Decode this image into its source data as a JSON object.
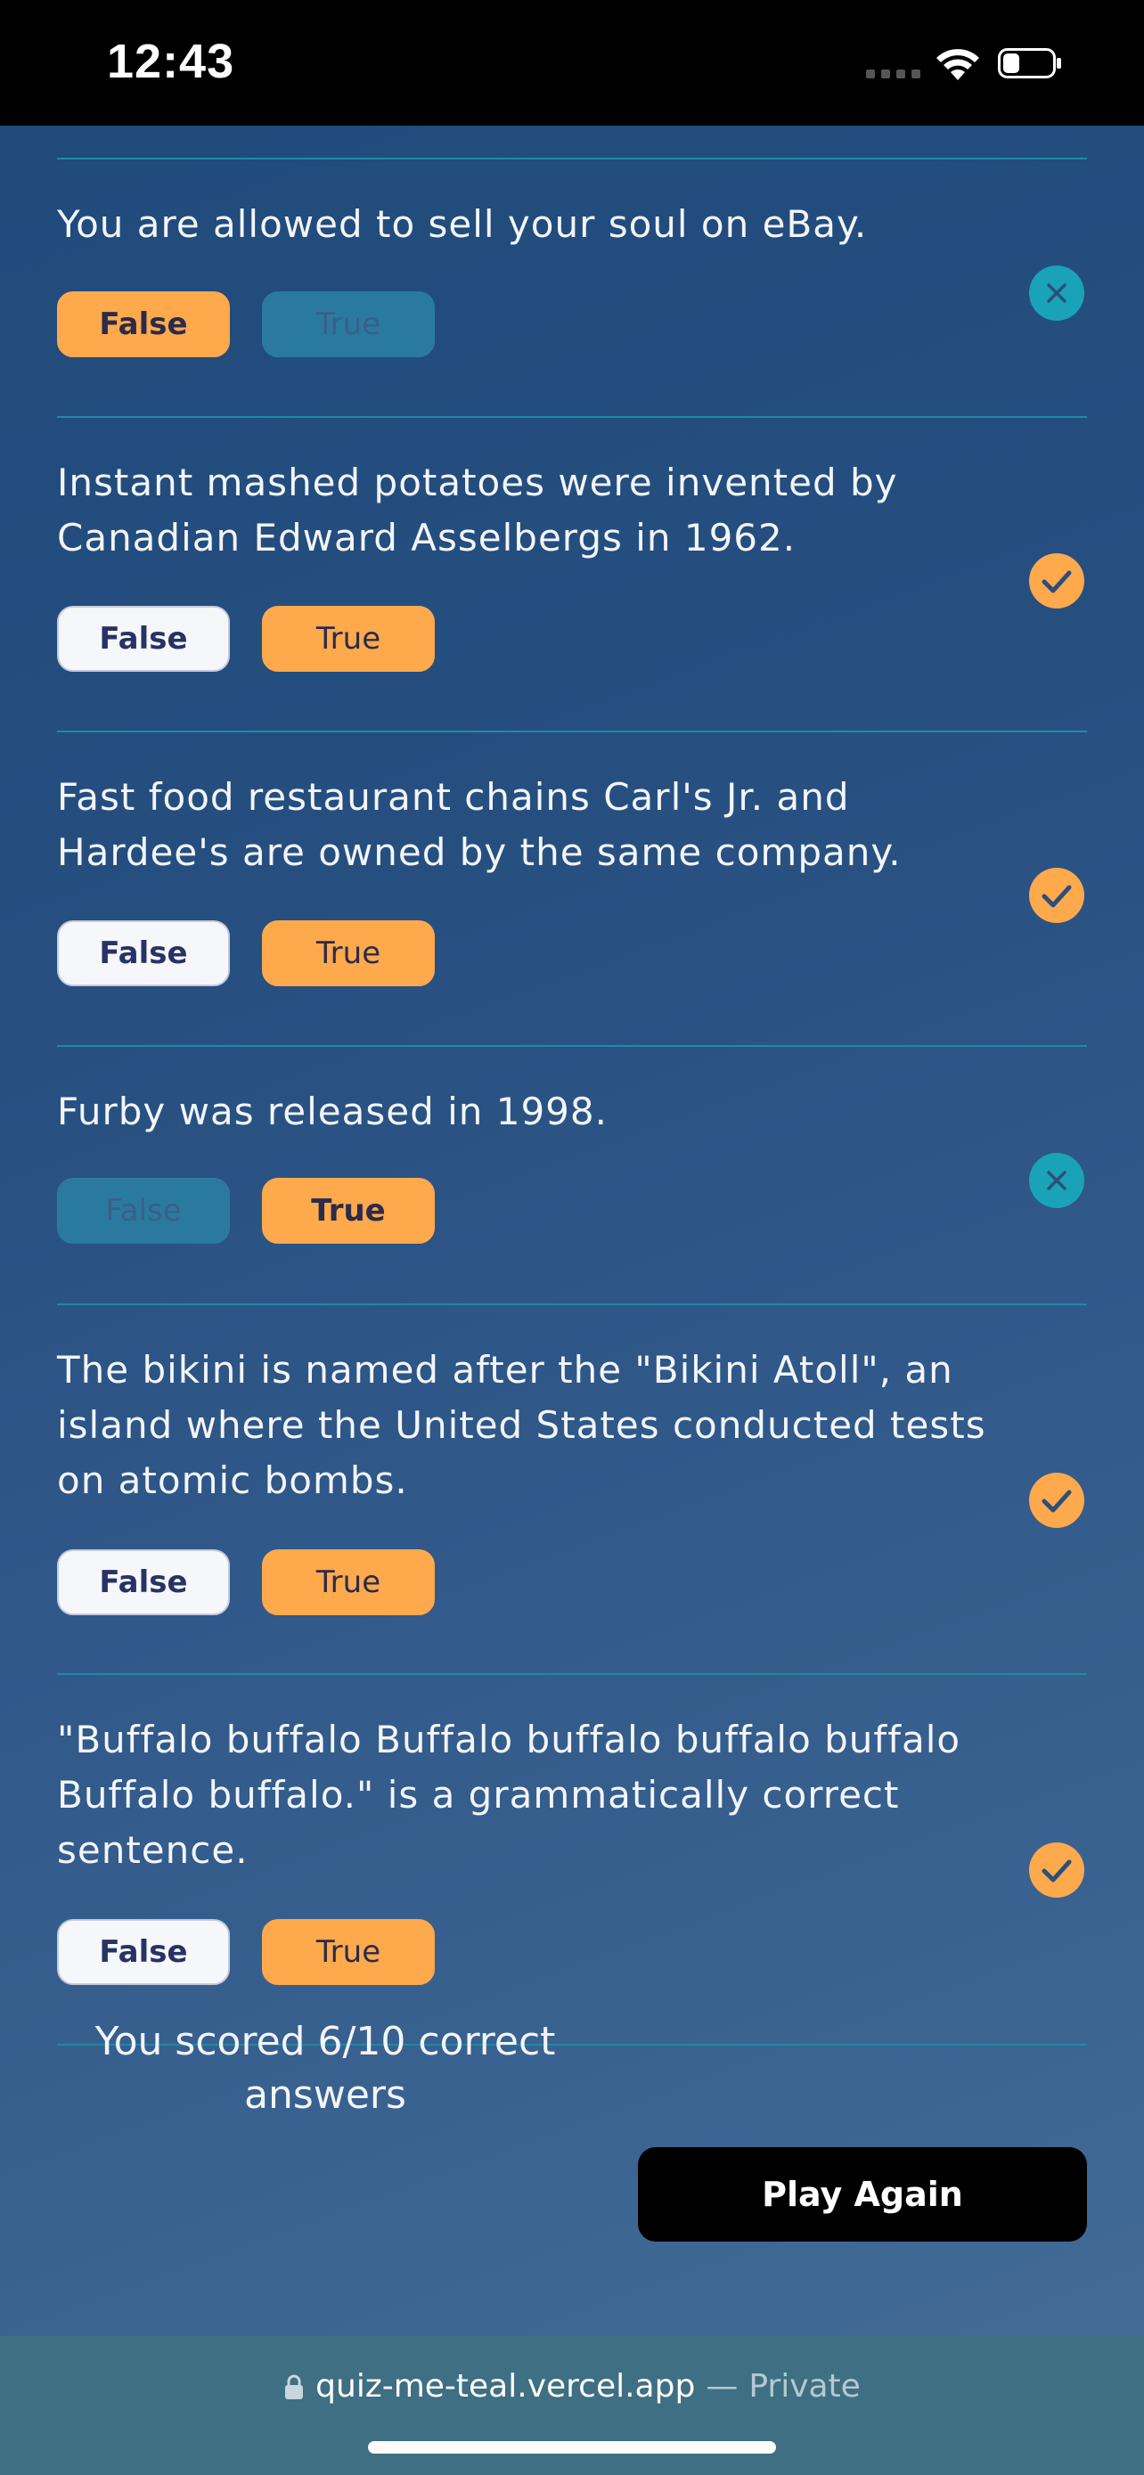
{
  "status_bar": {
    "time": "12:43"
  },
  "colors": {
    "selected": "#ffa94d",
    "correct_mark": "#ffa94d",
    "wrong_mark": "#1aa3b8",
    "divider": "#1d8aa6"
  },
  "questions": [
    {
      "text": "You are allowed to sell your soul on eBay.",
      "false_label": "False",
      "true_label": "True",
      "result": "incorrect",
      "result_icon": "x-circle-icon"
    },
    {
      "text": "Instant mashed potatoes were invented by Canadian Edward Asselbergs in 1962.",
      "false_label": "False",
      "true_label": "True",
      "result": "correct",
      "result_icon": "check-circle-icon"
    },
    {
      "text": "Fast food restaurant chains Carl's Jr. and Hardee's are owned by the same company.",
      "false_label": "False",
      "true_label": "True",
      "result": "correct",
      "result_icon": "check-circle-icon"
    },
    {
      "text": "Furby was released in 1998.",
      "false_label": "False",
      "true_label": "True",
      "result": "incorrect",
      "result_icon": "x-circle-icon"
    },
    {
      "text": "The bikini is named after the \"Bikini Atoll\", an island where the United States conducted tests on atomic bombs.",
      "false_label": "False",
      "true_label": "True",
      "result": "correct",
      "result_icon": "check-circle-icon"
    },
    {
      "text": "\"Buffalo buffalo Buffalo buffalo buffalo buffalo Buffalo buffalo.\" is a grammatically correct sentence.",
      "false_label": "False",
      "true_label": "True",
      "result": "correct",
      "result_icon": "check-circle-icon"
    }
  ],
  "footer": {
    "score_text": "You scored 6/10 correct answers",
    "play_again": "Play Again"
  },
  "browser": {
    "url": "quiz-me-teal.vercel.app",
    "separator": "—",
    "mode": "Private"
  }
}
